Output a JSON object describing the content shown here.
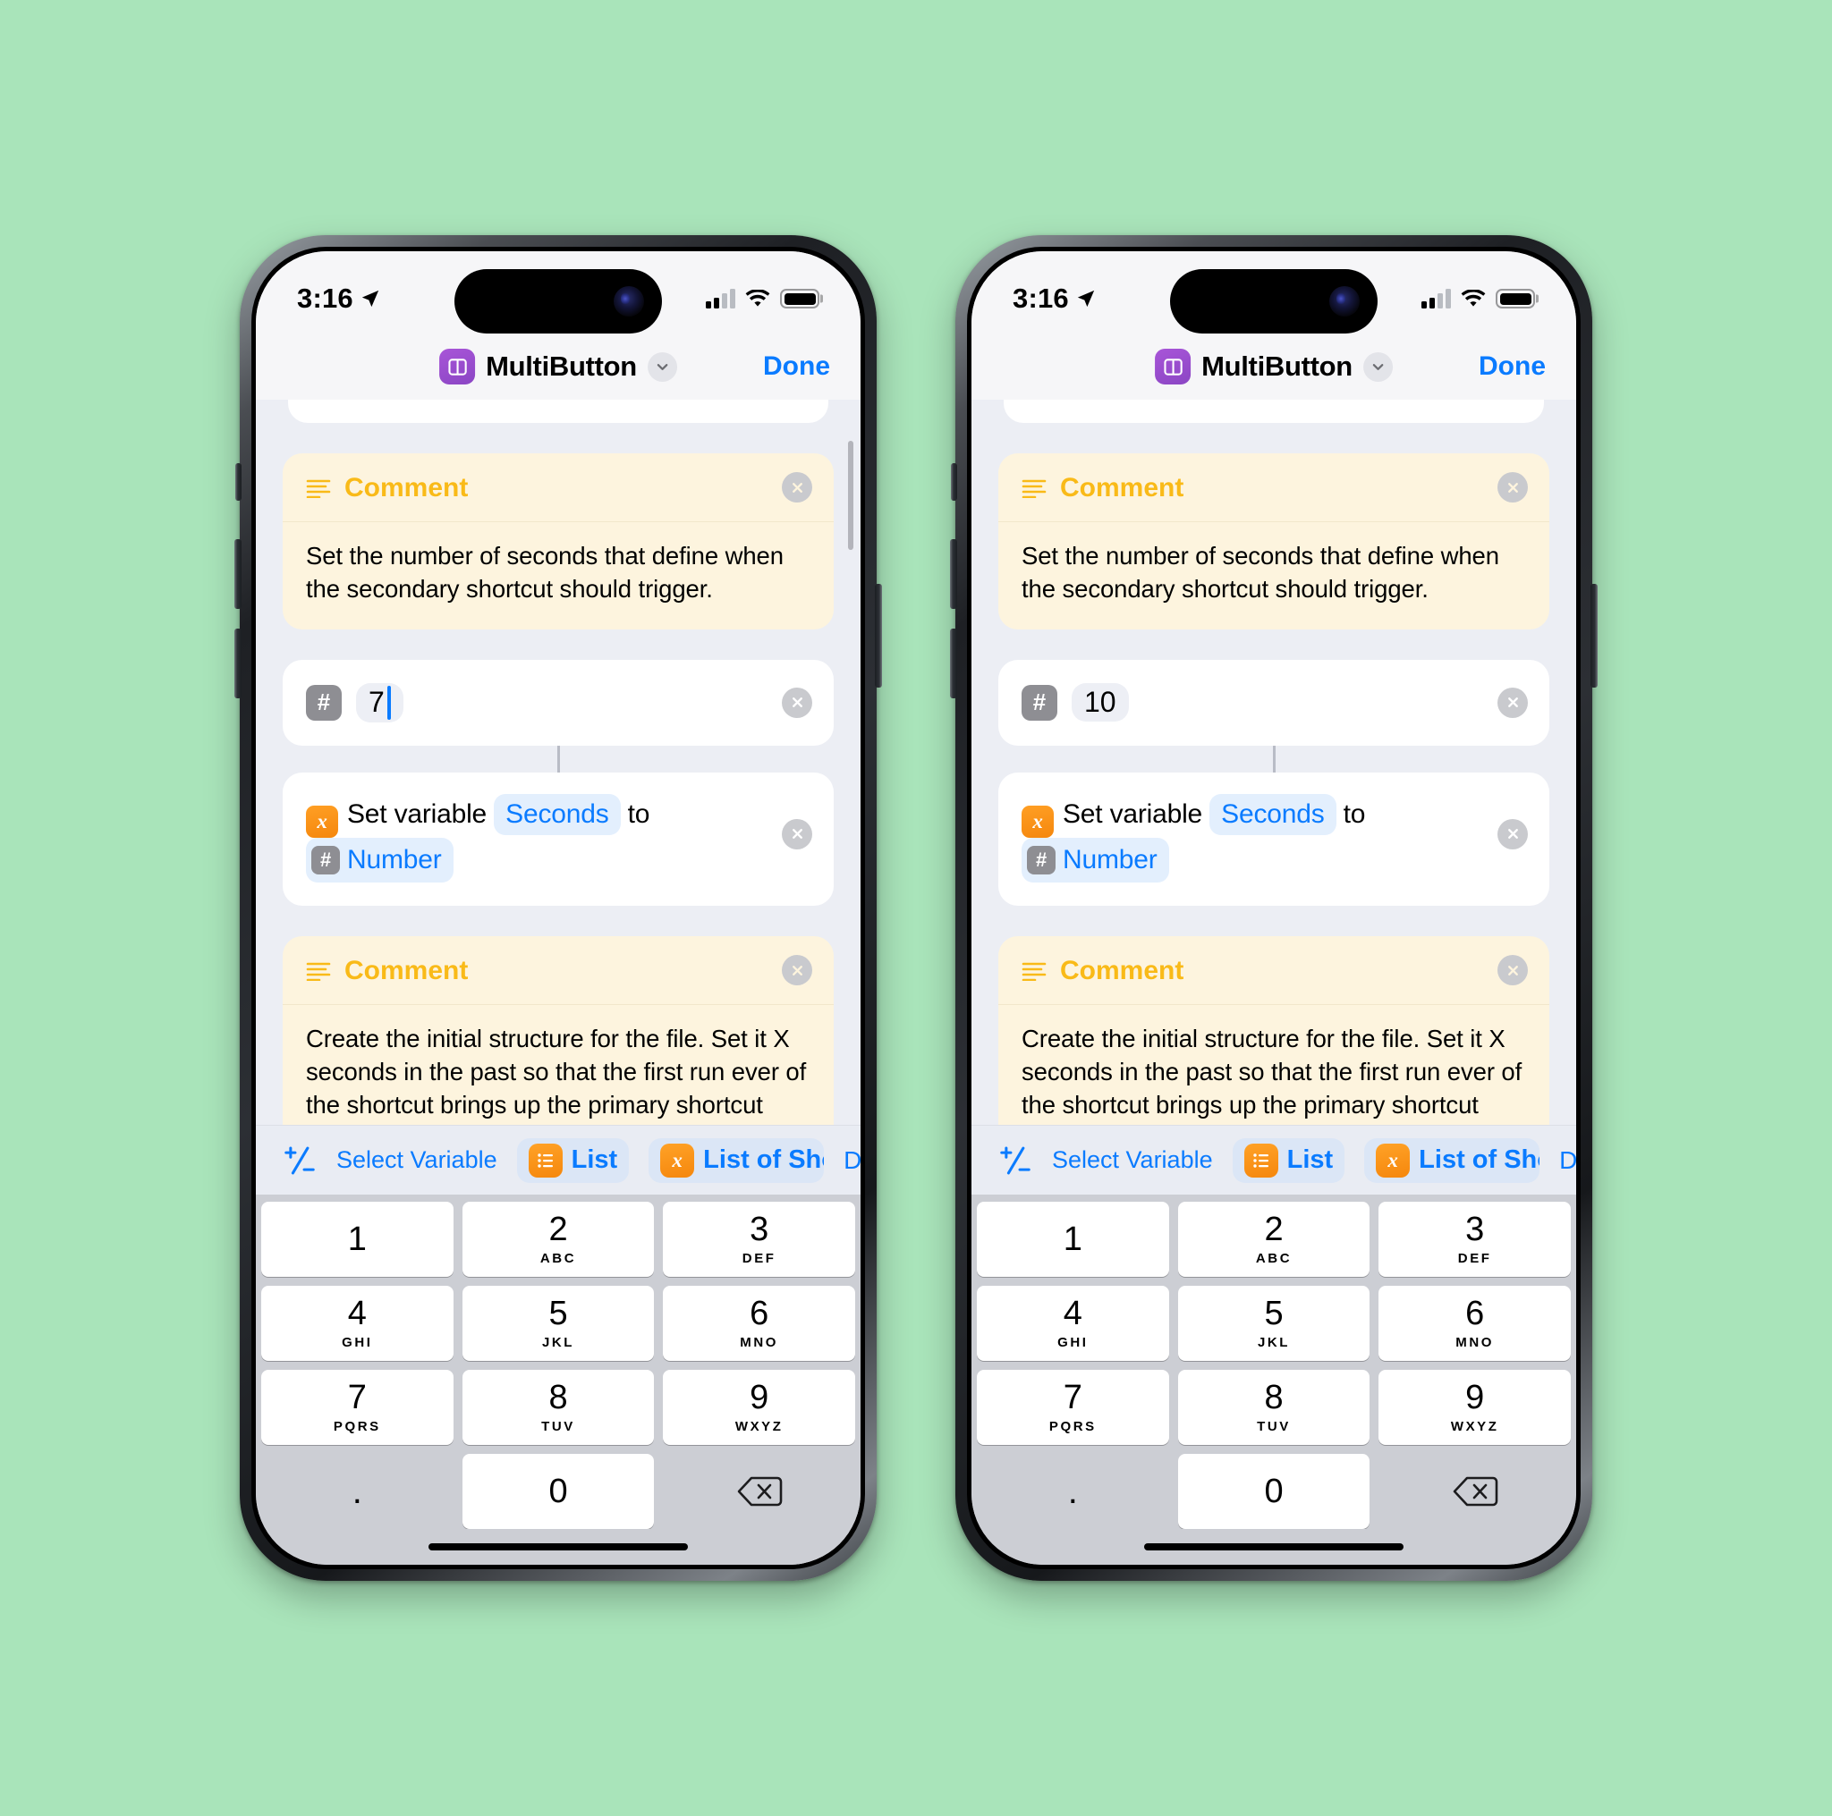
{
  "meta": {
    "app": "Shortcuts",
    "screen": "Shortcut Editor",
    "accent_blue": "#0a7bff",
    "comment_bg": "#fdf4de",
    "comment_yellow": "#f9ba18",
    "orange": "#f5870d",
    "gray_badge": "#8e8e93",
    "canvas_bg": "#eceef4",
    "keypad_bg": "#ccced4",
    "stage_bg": "#a9e4ba"
  },
  "status_bar": {
    "time": "3:16",
    "location_icon": "location-arrow-icon",
    "cellular_icon": "cellular-bars-icon",
    "wifi_icon": "wifi-icon",
    "battery_icon": "battery-icon"
  },
  "nav": {
    "app_icon": "multibutton-app-icon",
    "title": "MultiButton",
    "chevron_icon": "chevron-down-icon",
    "done_label": "Done"
  },
  "actions": {
    "comment1": {
      "icon": "comment-lines-icon",
      "title": "Comment",
      "text": "Set the number of seconds that define when the secondary shortcut should trigger.",
      "delete_icon": "close-circle-icon"
    },
    "number": {
      "badge": "#",
      "delete_icon": "close-circle-icon"
    },
    "set_variable": {
      "icon": "x-variable-icon",
      "prefix": "Set variable",
      "variable_name": "Seconds",
      "middle": "to",
      "value_badge": "#",
      "value_name": "Number",
      "delete_icon": "close-circle-icon"
    },
    "comment2": {
      "icon": "comment-lines-icon",
      "title": "Comment",
      "text": "Create the initial structure for the file. Set it X seconds in the past so that the first run ever of the shortcut brings up the primary shortcut assigned.",
      "delete_icon": "close-circle-icon"
    }
  },
  "variable_toolbar": {
    "plus_minus_icon": "plus-minus-icon",
    "select_variable_label": "Select Variable",
    "chips": [
      {
        "icon": "list-icon",
        "label": "List"
      },
      {
        "icon": "x-variable-icon",
        "label": "List of Shor"
      }
    ],
    "done_label": "Done"
  },
  "keypad": {
    "rows": [
      [
        {
          "num": "1",
          "sub": ""
        },
        {
          "num": "2",
          "sub": "ABC"
        },
        {
          "num": "3",
          "sub": "DEF"
        }
      ],
      [
        {
          "num": "4",
          "sub": "GHI"
        },
        {
          "num": "5",
          "sub": "JKL"
        },
        {
          "num": "6",
          "sub": "MNO"
        }
      ],
      [
        {
          "num": "7",
          "sub": "PQRS"
        },
        {
          "num": "8",
          "sub": "TUV"
        },
        {
          "num": "9",
          "sub": "WXYZ"
        }
      ],
      [
        {
          "num": ".",
          "sub": ""
        },
        {
          "num": "0",
          "sub": ""
        },
        {
          "num": "",
          "sub": "",
          "icon": "backspace-icon"
        }
      ]
    ]
  },
  "phones": [
    {
      "id": "left",
      "number_value": "7",
      "caret_visible": true
    },
    {
      "id": "right",
      "number_value": "10",
      "caret_visible": false
    }
  ]
}
